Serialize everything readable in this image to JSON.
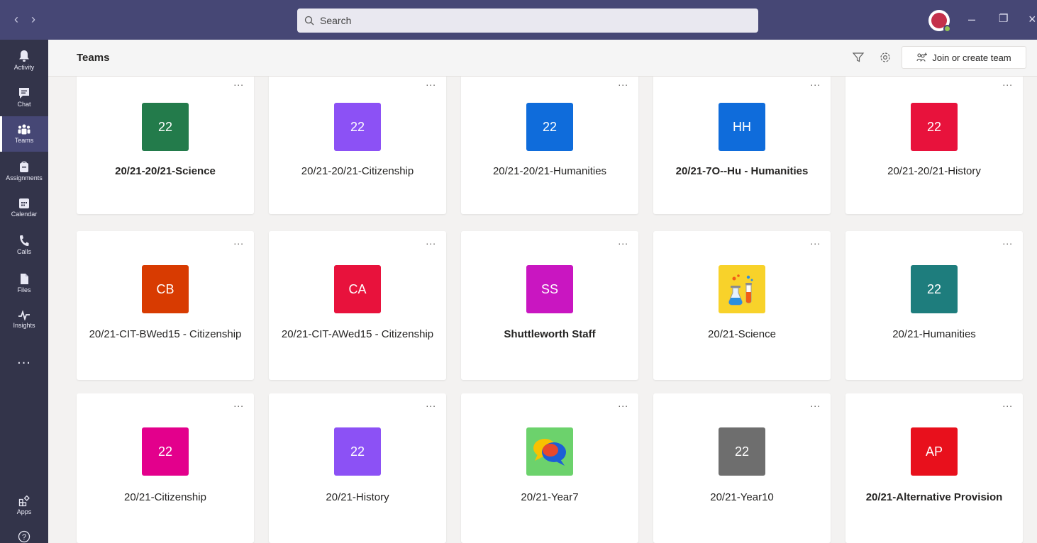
{
  "window": {
    "nav_back": "‹",
    "nav_forward": "›",
    "search_placeholder": "Search",
    "minimize": "–",
    "maximize": "❐",
    "close": "×"
  },
  "rail": {
    "items": [
      {
        "label": "Activity",
        "icon": "bell-icon"
      },
      {
        "label": "Chat",
        "icon": "chat-icon"
      },
      {
        "label": "Teams",
        "icon": "teams-icon",
        "active": true
      },
      {
        "label": "Assignments",
        "icon": "assignments-icon"
      },
      {
        "label": "Calendar",
        "icon": "calendar-icon"
      },
      {
        "label": "Calls",
        "icon": "phone-icon"
      },
      {
        "label": "Files",
        "icon": "file-icon"
      },
      {
        "label": "Insights",
        "icon": "insights-icon"
      }
    ],
    "more": "...",
    "apps_label": "Apps",
    "help": "?"
  },
  "header": {
    "title": "Teams",
    "join_button": "Join or create team"
  },
  "teams": [
    {
      "tile": "22",
      "color": "#237b4b",
      "name": "20/21-20/21-Science",
      "bold": true
    },
    {
      "tile": "22",
      "color": "#8c51f5",
      "name": "20/21-20/21-Citizenship",
      "bold": false
    },
    {
      "tile": "22",
      "color": "#0f6cdb",
      "name": "20/21-20/21-Humanities",
      "bold": false
    },
    {
      "tile": "HH",
      "color": "#0f6cdb",
      "name": "20/21-7O--Hu - Humanities",
      "bold": true
    },
    {
      "tile": "22",
      "color": "#e8123c",
      "name": "20/21-20/21-History",
      "bold": false
    },
    {
      "tile": "CB",
      "color": "#d83b01",
      "name": "20/21-CIT-BWed15 - Citizenship",
      "bold": false
    },
    {
      "tile": "CA",
      "color": "#e8123c",
      "name": "20/21-CIT-AWed15 - Citizenship",
      "bold": false
    },
    {
      "tile": "SS",
      "color": "#c916c1",
      "name": "Shuttleworth Staff",
      "bold": true
    },
    {
      "tile": "",
      "color": "#f8d22a",
      "name": "20/21-Science",
      "bold": false,
      "icon": "science-flask-icon"
    },
    {
      "tile": "22",
      "color": "#1e7d7d",
      "name": "20/21-Humanities",
      "bold": false
    },
    {
      "tile": "22",
      "color": "#e3008c",
      "name": "20/21-Citizenship",
      "bold": false
    },
    {
      "tile": "22",
      "color": "#8c51f5",
      "name": "20/21-History",
      "bold": false
    },
    {
      "tile": "",
      "color": "#6cd26c",
      "name": "20/21-Year7",
      "bold": false,
      "icon": "speech-bubbles-icon"
    },
    {
      "tile": "22",
      "color": "#6e6e6e",
      "name": "20/21-Year10",
      "bold": false
    },
    {
      "tile": "AP",
      "color": "#e8101c",
      "name": "20/21-Alternative Provision",
      "bold": true
    }
  ],
  "card_more": "..."
}
